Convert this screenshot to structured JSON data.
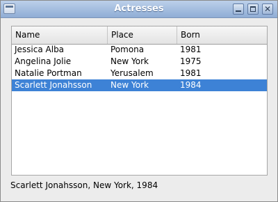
{
  "window": {
    "title": "Actresses"
  },
  "table": {
    "columns": [
      "Name",
      "Place",
      "Born"
    ],
    "rows": [
      {
        "name": "Jessica Alba",
        "place": "Pomona",
        "born": "1981"
      },
      {
        "name": "Angelina Jolie",
        "place": "New York",
        "born": "1975"
      },
      {
        "name": "Natalie Portman",
        "place": "Yerusalem",
        "born": "1981"
      },
      {
        "name": "Scarlett Jonahsson",
        "place": "New York",
        "born": "1984"
      }
    ],
    "selected_index": 3
  },
  "status": {
    "text": "Scarlett Jonahsson, New York, 1984"
  },
  "colors": {
    "selection": "#3d82d6",
    "titlebar": "#8fadd5"
  }
}
